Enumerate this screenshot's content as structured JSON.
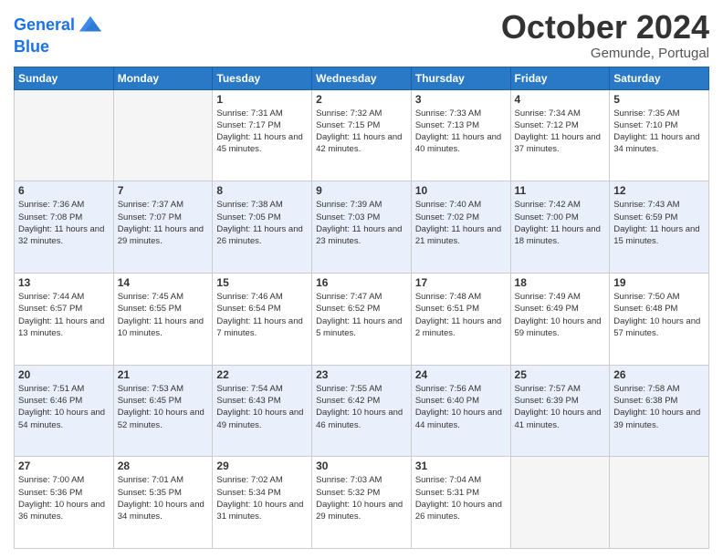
{
  "header": {
    "logo_line1": "General",
    "logo_line2": "Blue",
    "month": "October 2024",
    "location": "Gemunde, Portugal"
  },
  "weekdays": [
    "Sunday",
    "Monday",
    "Tuesday",
    "Wednesday",
    "Thursday",
    "Friday",
    "Saturday"
  ],
  "weeks": [
    [
      {
        "day": "",
        "sunrise": "",
        "sunset": "",
        "daylight": ""
      },
      {
        "day": "",
        "sunrise": "",
        "sunset": "",
        "daylight": ""
      },
      {
        "day": "1",
        "sunrise": "Sunrise: 7:31 AM",
        "sunset": "Sunset: 7:17 PM",
        "daylight": "Daylight: 11 hours and 45 minutes."
      },
      {
        "day": "2",
        "sunrise": "Sunrise: 7:32 AM",
        "sunset": "Sunset: 7:15 PM",
        "daylight": "Daylight: 11 hours and 42 minutes."
      },
      {
        "day": "3",
        "sunrise": "Sunrise: 7:33 AM",
        "sunset": "Sunset: 7:13 PM",
        "daylight": "Daylight: 11 hours and 40 minutes."
      },
      {
        "day": "4",
        "sunrise": "Sunrise: 7:34 AM",
        "sunset": "Sunset: 7:12 PM",
        "daylight": "Daylight: 11 hours and 37 minutes."
      },
      {
        "day": "5",
        "sunrise": "Sunrise: 7:35 AM",
        "sunset": "Sunset: 7:10 PM",
        "daylight": "Daylight: 11 hours and 34 minutes."
      }
    ],
    [
      {
        "day": "6",
        "sunrise": "Sunrise: 7:36 AM",
        "sunset": "Sunset: 7:08 PM",
        "daylight": "Daylight: 11 hours and 32 minutes."
      },
      {
        "day": "7",
        "sunrise": "Sunrise: 7:37 AM",
        "sunset": "Sunset: 7:07 PM",
        "daylight": "Daylight: 11 hours and 29 minutes."
      },
      {
        "day": "8",
        "sunrise": "Sunrise: 7:38 AM",
        "sunset": "Sunset: 7:05 PM",
        "daylight": "Daylight: 11 hours and 26 minutes."
      },
      {
        "day": "9",
        "sunrise": "Sunrise: 7:39 AM",
        "sunset": "Sunset: 7:03 PM",
        "daylight": "Daylight: 11 hours and 23 minutes."
      },
      {
        "day": "10",
        "sunrise": "Sunrise: 7:40 AM",
        "sunset": "Sunset: 7:02 PM",
        "daylight": "Daylight: 11 hours and 21 minutes."
      },
      {
        "day": "11",
        "sunrise": "Sunrise: 7:42 AM",
        "sunset": "Sunset: 7:00 PM",
        "daylight": "Daylight: 11 hours and 18 minutes."
      },
      {
        "day": "12",
        "sunrise": "Sunrise: 7:43 AM",
        "sunset": "Sunset: 6:59 PM",
        "daylight": "Daylight: 11 hours and 15 minutes."
      }
    ],
    [
      {
        "day": "13",
        "sunrise": "Sunrise: 7:44 AM",
        "sunset": "Sunset: 6:57 PM",
        "daylight": "Daylight: 11 hours and 13 minutes."
      },
      {
        "day": "14",
        "sunrise": "Sunrise: 7:45 AM",
        "sunset": "Sunset: 6:55 PM",
        "daylight": "Daylight: 11 hours and 10 minutes."
      },
      {
        "day": "15",
        "sunrise": "Sunrise: 7:46 AM",
        "sunset": "Sunset: 6:54 PM",
        "daylight": "Daylight: 11 hours and 7 minutes."
      },
      {
        "day": "16",
        "sunrise": "Sunrise: 7:47 AM",
        "sunset": "Sunset: 6:52 PM",
        "daylight": "Daylight: 11 hours and 5 minutes."
      },
      {
        "day": "17",
        "sunrise": "Sunrise: 7:48 AM",
        "sunset": "Sunset: 6:51 PM",
        "daylight": "Daylight: 11 hours and 2 minutes."
      },
      {
        "day": "18",
        "sunrise": "Sunrise: 7:49 AM",
        "sunset": "Sunset: 6:49 PM",
        "daylight": "Daylight: 10 hours and 59 minutes."
      },
      {
        "day": "19",
        "sunrise": "Sunrise: 7:50 AM",
        "sunset": "Sunset: 6:48 PM",
        "daylight": "Daylight: 10 hours and 57 minutes."
      }
    ],
    [
      {
        "day": "20",
        "sunrise": "Sunrise: 7:51 AM",
        "sunset": "Sunset: 6:46 PM",
        "daylight": "Daylight: 10 hours and 54 minutes."
      },
      {
        "day": "21",
        "sunrise": "Sunrise: 7:53 AM",
        "sunset": "Sunset: 6:45 PM",
        "daylight": "Daylight: 10 hours and 52 minutes."
      },
      {
        "day": "22",
        "sunrise": "Sunrise: 7:54 AM",
        "sunset": "Sunset: 6:43 PM",
        "daylight": "Daylight: 10 hours and 49 minutes."
      },
      {
        "day": "23",
        "sunrise": "Sunrise: 7:55 AM",
        "sunset": "Sunset: 6:42 PM",
        "daylight": "Daylight: 10 hours and 46 minutes."
      },
      {
        "day": "24",
        "sunrise": "Sunrise: 7:56 AM",
        "sunset": "Sunset: 6:40 PM",
        "daylight": "Daylight: 10 hours and 44 minutes."
      },
      {
        "day": "25",
        "sunrise": "Sunrise: 7:57 AM",
        "sunset": "Sunset: 6:39 PM",
        "daylight": "Daylight: 10 hours and 41 minutes."
      },
      {
        "day": "26",
        "sunrise": "Sunrise: 7:58 AM",
        "sunset": "Sunset: 6:38 PM",
        "daylight": "Daylight: 10 hours and 39 minutes."
      }
    ],
    [
      {
        "day": "27",
        "sunrise": "Sunrise: 7:00 AM",
        "sunset": "Sunset: 5:36 PM",
        "daylight": "Daylight: 10 hours and 36 minutes."
      },
      {
        "day": "28",
        "sunrise": "Sunrise: 7:01 AM",
        "sunset": "Sunset: 5:35 PM",
        "daylight": "Daylight: 10 hours and 34 minutes."
      },
      {
        "day": "29",
        "sunrise": "Sunrise: 7:02 AM",
        "sunset": "Sunset: 5:34 PM",
        "daylight": "Daylight: 10 hours and 31 minutes."
      },
      {
        "day": "30",
        "sunrise": "Sunrise: 7:03 AM",
        "sunset": "Sunset: 5:32 PM",
        "daylight": "Daylight: 10 hours and 29 minutes."
      },
      {
        "day": "31",
        "sunrise": "Sunrise: 7:04 AM",
        "sunset": "Sunset: 5:31 PM",
        "daylight": "Daylight: 10 hours and 26 minutes."
      },
      {
        "day": "",
        "sunrise": "",
        "sunset": "",
        "daylight": ""
      },
      {
        "day": "",
        "sunrise": "",
        "sunset": "",
        "daylight": ""
      }
    ]
  ]
}
